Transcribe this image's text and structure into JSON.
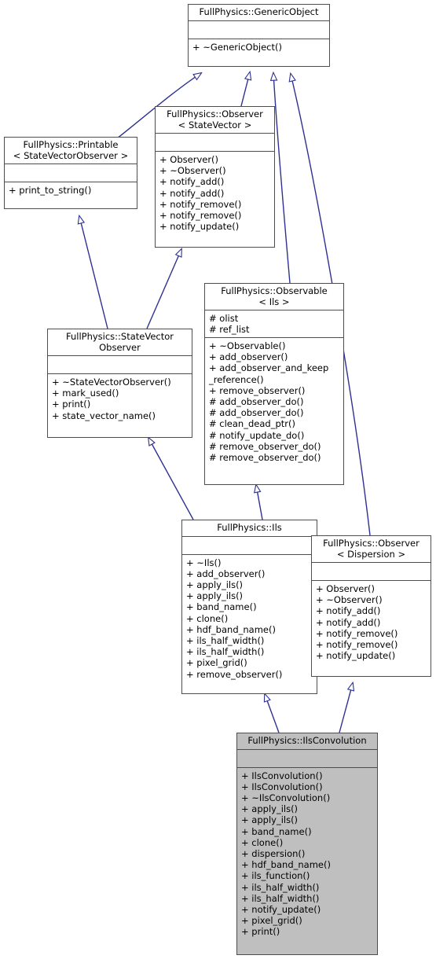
{
  "diagram": {
    "type": "uml-class-inheritance",
    "title": "FullPhysics::IlsConvolution inheritance diagram",
    "line_color": "#2e3192",
    "node_border_color": "#4d4d4d",
    "node_fill_color": "#ffffff",
    "highlight_fill_color": "#bfbfbf",
    "text_color": "#000000"
  },
  "nodes": {
    "generic_object": {
      "title": "FullPhysics::GenericObject",
      "attributes": [],
      "operations": [
        "+ ~GenericObject()"
      ]
    },
    "observer_statevector": {
      "title": "FullPhysics::Observer\n< StateVector >",
      "attributes": [],
      "operations": [
        "+ Observer()",
        "+ ~Observer()",
        "+ notify_add()",
        "+ notify_add()",
        "+ notify_remove()",
        "+ notify_remove()",
        "+ notify_update()"
      ]
    },
    "printable_statevectorobserver": {
      "title": "FullPhysics::Printable\n< StateVectorObserver >",
      "attributes": [],
      "operations": [
        "+ print_to_string()"
      ]
    },
    "observable_ils": {
      "title": "FullPhysics::Observable\n< Ils >",
      "attributes": [
        "# olist",
        "# ref_list"
      ],
      "operations": [
        "+ ~Observable()",
        "+ add_observer()",
        "+ add_observer_and_keep\n_reference()",
        "+ remove_observer()",
        "# add_observer_do()",
        "# add_observer_do()",
        "# clean_dead_ptr()",
        "# notify_update_do()",
        "# remove_observer_do()",
        "# remove_observer_do()"
      ]
    },
    "statevector_observer": {
      "title": "FullPhysics::StateVector\nObserver",
      "attributes": [],
      "operations": [
        "+ ~StateVectorObserver()",
        "+ mark_used()",
        "+ print()",
        "+ state_vector_name()"
      ]
    },
    "ils": {
      "title": "FullPhysics::Ils",
      "attributes": [],
      "operations": [
        "+ ~Ils()",
        "+ add_observer()",
        "+ apply_ils()",
        "+ apply_ils()",
        "+ band_name()",
        "+ clone()",
        "+ hdf_band_name()",
        "+ ils_half_width()",
        "+ ils_half_width()",
        "+ pixel_grid()",
        "+ remove_observer()"
      ]
    },
    "observer_dispersion": {
      "title": "FullPhysics::Observer\n< Dispersion >",
      "attributes": [],
      "operations": [
        "+ Observer()",
        "+ ~Observer()",
        "+ notify_add()",
        "+ notify_add()",
        "+ notify_remove()",
        "+ notify_remove()",
        "+ notify_update()"
      ]
    },
    "ils_convolution": {
      "title": "FullPhysics::IlsConvolution",
      "attributes": [],
      "operations": [
        "+ IlsConvolution()",
        "+ IlsConvolution()",
        "+ ~IlsConvolution()",
        "+ apply_ils()",
        "+ apply_ils()",
        "+ band_name()",
        "+ clone()",
        "+ dispersion()",
        "+ hdf_band_name()",
        "+ ils_function()",
        "+ ils_half_width()",
        "+ ils_half_width()",
        "+ notify_update()",
        "+ pixel_grid()",
        "+ print()"
      ]
    }
  },
  "edges": [
    {
      "from": "printable_statevectorobserver",
      "to": "generic_object",
      "kind": "generalization"
    },
    {
      "from": "observer_statevector",
      "to": "generic_object",
      "kind": "generalization"
    },
    {
      "from": "observable_ils",
      "to": "generic_object",
      "kind": "generalization"
    },
    {
      "from": "observer_dispersion",
      "to": "generic_object",
      "kind": "generalization"
    },
    {
      "from": "statevector_observer",
      "to": "printable_statevectorobserver",
      "kind": "generalization"
    },
    {
      "from": "statevector_observer",
      "to": "observer_statevector",
      "kind": "generalization"
    },
    {
      "from": "ils",
      "to": "statevector_observer",
      "kind": "generalization"
    },
    {
      "from": "ils",
      "to": "observable_ils",
      "kind": "generalization"
    },
    {
      "from": "ils_convolution",
      "to": "ils",
      "kind": "generalization"
    },
    {
      "from": "ils_convolution",
      "to": "observer_dispersion",
      "kind": "generalization"
    }
  ]
}
